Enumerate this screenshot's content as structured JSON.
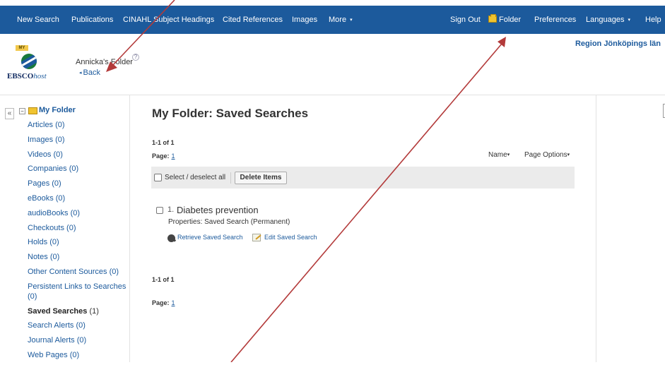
{
  "navbar": {
    "left_items": [
      {
        "label": "New Search",
        "has_caret": false
      },
      {
        "label": "Publications",
        "has_caret": false
      },
      {
        "label": "CINAHL Subject Headings",
        "has_caret": false
      },
      {
        "label": "Cited References",
        "has_caret": false
      },
      {
        "label": "Images",
        "has_caret": false
      },
      {
        "label": "More",
        "has_caret": true
      }
    ],
    "right_items": [
      {
        "label": "Sign Out",
        "has_caret": false
      },
      {
        "label": "Folder",
        "has_caret": false,
        "icon": "folder-icon"
      },
      {
        "label": "Preferences",
        "has_caret": false
      },
      {
        "label": "Languages",
        "has_caret": true
      },
      {
        "label": "Help",
        "has_caret": false
      }
    ],
    "caret_glyph": "▾"
  },
  "header": {
    "logo_badge": "MY",
    "logo_text_main": "EBSCO",
    "logo_text_italic": "host",
    "folder_owner": "Annicka's Folder",
    "help_glyph": "?",
    "back_label": "Back",
    "back_glyph": "◂",
    "organization": "Region Jönköpings län"
  },
  "sidebar": {
    "collapse_glyph": "«",
    "tree_toggle_glyph": "⊟",
    "root_label": "My Folder",
    "items": [
      {
        "label": "Articles",
        "count": "(0)",
        "active": false
      },
      {
        "label": "Images",
        "count": "(0)",
        "active": false
      },
      {
        "label": "Videos",
        "count": "(0)",
        "active": false
      },
      {
        "label": "Companies",
        "count": "(0)",
        "active": false
      },
      {
        "label": "Pages",
        "count": "(0)",
        "active": false
      },
      {
        "label": "eBooks",
        "count": "(0)",
        "active": false
      },
      {
        "label": "audioBooks",
        "count": "(0)",
        "active": false
      },
      {
        "label": "Checkouts",
        "count": "(0)",
        "active": false
      },
      {
        "label": "Holds",
        "count": "(0)",
        "active": false
      },
      {
        "label": "Notes",
        "count": "(0)",
        "active": false
      },
      {
        "label": "Other Content Sources",
        "count": "(0)",
        "active": false
      },
      {
        "label": "Persistent Links to Searches",
        "count": "(0)",
        "active": false
      },
      {
        "label": "Saved Searches",
        "count": "(1)",
        "active": true
      },
      {
        "label": "Search Alerts",
        "count": "(0)",
        "active": false
      },
      {
        "label": "Journal Alerts",
        "count": "(0)",
        "active": false
      },
      {
        "label": "Web Pages",
        "count": "(0)",
        "active": false
      }
    ]
  },
  "main": {
    "title": "My Folder: Saved Searches",
    "results_count": "1-1 of 1",
    "page_label": "Page:",
    "page_number": "1",
    "sort_label": "Name",
    "options_label": "Page Options",
    "dropdown_glyph": "▾",
    "select_all_label": "Select / deselect all",
    "delete_label": "Delete Items",
    "result": {
      "number": "1.",
      "title": "Diabetes prevention",
      "properties": "Properties: Saved Search (Permanent)",
      "retrieve_label": "Retrieve Saved Search",
      "edit_label": "Edit Saved Search"
    },
    "results_count_bottom": "1-1 of 1",
    "page_label_bottom": "Page:",
    "page_number_bottom": "1"
  },
  "colors": {
    "navbar_bg": "#1c5a9c",
    "link": "#1c5a9c",
    "annotation_arrow": "#b33a3a"
  }
}
